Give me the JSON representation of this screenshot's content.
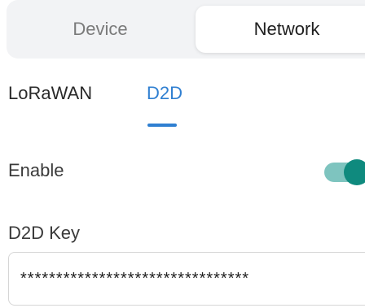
{
  "segment_tabs": {
    "device": "Device",
    "network": "Network",
    "selected": "Network"
  },
  "sub_tabs": {
    "lorawan": "LoRaWAN",
    "d2d": "D2D",
    "selected": "D2D"
  },
  "enable": {
    "label": "Enable",
    "state": "on"
  },
  "d2d_key": {
    "label": "D2D Key",
    "value": "********************************"
  },
  "colors": {
    "accent": "#2f7fd1",
    "toggle_on": "#0f8a7e"
  }
}
